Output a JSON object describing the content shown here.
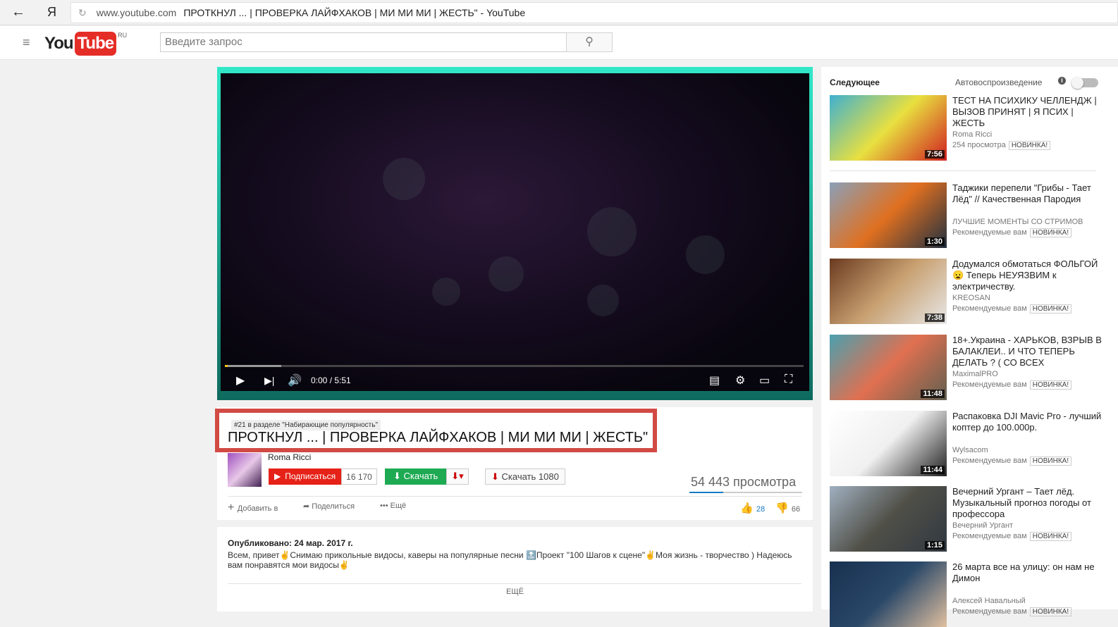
{
  "browser": {
    "address_domain": "www.youtube.com",
    "page_title": "ПРОТКНУЛ ... | ПРОВЕРКА ЛАЙФХАКОВ | МИ МИ МИ | ЖЕСТЬ\" - YouTube",
    "back_icon": "←",
    "yandex_logo": "Я",
    "reload_icon": "↻"
  },
  "header": {
    "logo_you": "You",
    "logo_tube": "Tube",
    "logo_region": "RU",
    "search_placeholder": "Введите запрос",
    "menu_icon": "≡",
    "search_icon": "⚲"
  },
  "player": {
    "time": "0:00 / 5:51",
    "progress": 0.0,
    "buffered_fraction": 0.1,
    "accent": "#30e8c8"
  },
  "video": {
    "rank_badge": "#21 в разделе \"Набирающие популярность\"",
    "title": "ПРОТКНУЛ ... | ПРОВЕРКА ЛАЙФХАКОВ | МИ МИ МИ | ЖЕСТЬ\"",
    "channel": "Roma Ricci",
    "subscribe_label": "Подписаться",
    "subscriber_count": "16 170",
    "download_label": "Скачать",
    "download1080_label": "Скачать 1080",
    "views": "54 443 просмотра",
    "add_to_label": "Добавить в",
    "share_label": "Поделиться",
    "more_label": "Ещё",
    "likes": "28",
    "dislikes": "66",
    "highlight_color": "#d24a44"
  },
  "description": {
    "published": "Опубликовано: 24 мар. 2017 г.",
    "text": "Всем, привет✌Снимаю прикольные видосы, каверы на популярные песни 🔝Проект \"100 Шагов к сцене\"✌Моя жизнь - творчество ) Надеюсь вам понравятся мои видосы✌",
    "more_label": "ЕЩЁ"
  },
  "sidebar": {
    "next_label": "Следующее",
    "autoplay_label": "Автовоспроизведение",
    "autoplay_on": false,
    "items": [
      {
        "title": "ТЕСТ НА ПСИХИКУ ЧЕЛЛЕНДЖ | ВЫЗОВ ПРИНЯТ | Я ПСИХ | ЖЕСТЬ",
        "channel": "Roma Ricci",
        "sub": "254 просмотра",
        "badge": "НОВИНКА!",
        "duration": "7:56",
        "colors": [
          "#3fb0d0",
          "#e8e040",
          "#d02020"
        ]
      },
      {
        "title": "Таджики перепели \"Грибы - Тает Лёд\" // Качественная Пародия",
        "channel": "ЛУЧШИЕ МОМЕНТЫ СО СТРИМОВ",
        "sub": "Рекомендуемые вам",
        "badge": "НОВИНКА!",
        "duration": "1:30",
        "colors": [
          "#8aa0b8",
          "#e07020",
          "#203040"
        ]
      },
      {
        "title": "Додумался обмотаться ФОЛЬГОЙ 😦 Теперь НЕУЯЗВИМ к электричеству.",
        "channel": "KREOSAN",
        "sub": "Рекомендуемые вам",
        "badge": "НОВИНКА!",
        "duration": "7:38",
        "colors": [
          "#6a3a20",
          "#c8a070",
          "#e8e8e8"
        ]
      },
      {
        "title": "18+.Украина - ХАРЬКОВ, ВЗРЫВ В БАЛАКЛЕИ.. И ЧТО ТЕПЕРЬ ДЕЛАТЬ ? ( СО ВСЕХ",
        "channel": "MaximalPRO",
        "sub": "Рекомендуемые вам",
        "badge": "НОВИНКА!",
        "duration": "11:48",
        "colors": [
          "#4aa0b0",
          "#e07050",
          "#606050"
        ]
      },
      {
        "title": "Распаковка DJI Mavic Pro - лучший коптер до 100.000р.",
        "channel": "Wylsacom",
        "sub": "Рекомендуемые вам",
        "badge": "НОВИНКА!",
        "duration": "11:44",
        "colors": [
          "#ffffff",
          "#f0f0f0",
          "#202020"
        ]
      },
      {
        "title": "Вечерний Ургант – Тает лёд. Музыкальный прогноз погоды от профессора",
        "channel": "Вечерний Ургант",
        "sub": "Рекомендуемые вам",
        "badge": "НОВИНКА!",
        "duration": "1:15",
        "colors": [
          "#a0b0c0",
          "#505048",
          "#303840"
        ]
      },
      {
        "title": "26 марта все на улицу: он нам не Димон",
        "channel": "Алексей Навальный",
        "sub": "Рекомендуемые вам",
        "badge": "НОВИНКА!",
        "duration": "",
        "colors": [
          "#183050",
          "#2a4868",
          "#e0c0a0"
        ]
      }
    ]
  }
}
